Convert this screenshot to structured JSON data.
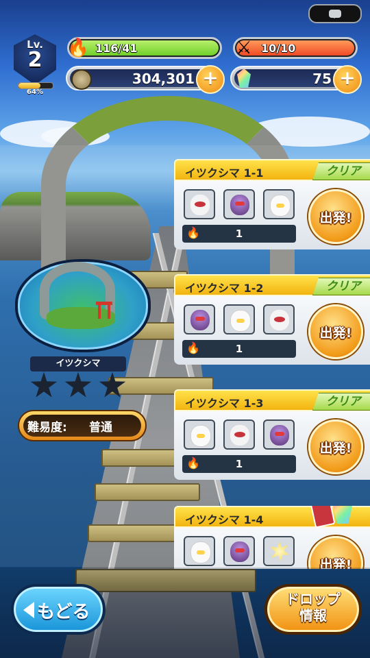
{
  "status": {
    "level_label": "Lv.",
    "level": "2",
    "xp_percent_text": "64%",
    "xp_fraction": 0.64,
    "stamina_text": "116/41",
    "stamina_fraction": 1.0,
    "tickets_text": "10/10",
    "tickets_fraction": 1.0,
    "gold": "304,301",
    "gems": "75",
    "plus_label": "+"
  },
  "map": {
    "name": "イツクシマ",
    "stars_total": 3,
    "stars_earned": 0,
    "difficulty_label": "難易度:",
    "difficulty_value": "普通"
  },
  "stages": [
    {
      "title": "イツクシマ 1-1",
      "badge": "クリア",
      "reward": "1",
      "button": "出発!",
      "monsters": [
        "bat",
        "purple",
        "cat"
      ]
    },
    {
      "title": "イツクシマ 1-2",
      "badge": "クリア",
      "reward": "1",
      "button": "出発!",
      "monsters": [
        "purple",
        "cat",
        "bat"
      ]
    },
    {
      "title": "イツクシマ 1-3",
      "badge": "クリア",
      "reward": "1",
      "button": "出発!",
      "monsters": [
        "cat",
        "bat",
        "purple"
      ]
    },
    {
      "title": "イツクシマ 1-4",
      "badge": "",
      "reward": "",
      "button": "出発!",
      "monsters": [
        "cat",
        "purple",
        "spiky"
      ]
    }
  ],
  "footer": {
    "back_label": "もどる",
    "drop_line1": "ドロップ",
    "drop_line2": "情報"
  },
  "colors": {
    "stamina_fill": "#6fcf2a",
    "ticket_fill": "#ef4a25",
    "accent_orange": "#f29b1a"
  }
}
